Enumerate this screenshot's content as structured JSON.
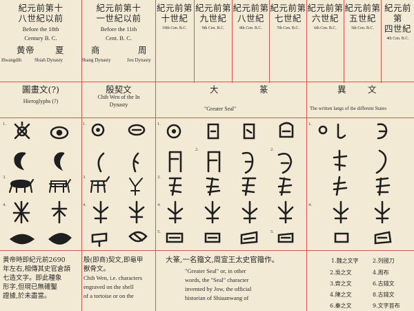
{
  "header": {
    "col1": {
      "cn_line1": "紀元前第十",
      "cn_line2": "八世紀以前",
      "en_line1": "Before the 18th",
      "en_line2": "Century B. C.",
      "cn_line3a": "黄帝",
      "cn_line3b": "夏",
      "en_line3a": "Hwangdih",
      "en_line3b": "Shiah Dynasty"
    },
    "col2": {
      "cn_line1": "紀元前第十",
      "cn_line2": "一世紀以前",
      "en_line1": "Before the 11th",
      "en_line2": "Cent. B. C.",
      "cn_line3a": "商",
      "cn_line3b": "周",
      "en_line3a": "Shang Dynasty",
      "en_line3b": "Jou Dynasty"
    },
    "cols": [
      {
        "cn_line1": "紀元前第",
        "cn_line2": "十世紀",
        "en": "10th Cen. B.C."
      },
      {
        "cn_line1": "紀元前第",
        "cn_line2": "九世紀",
        "en": "9th Cen. B.C."
      },
      {
        "cn_line1": "紀元前第",
        "cn_line2": "八世紀",
        "en": "8th Cen. B.C."
      },
      {
        "cn_line1": "紀元前第",
        "cn_line2": "七世紀",
        "en": "7th Cen. B.C."
      },
      {
        "cn_line1": "紀元前第",
        "cn_line2": "六世紀",
        "en": "6th Cen. B.C."
      },
      {
        "cn_line1": "紀元前第",
        "cn_line2": "五世紀",
        "en": "5th Cen. B.C."
      },
      {
        "cn_line1": "紀元前第",
        "cn_line2": "四世紀",
        "en": "4th Cen. B.C."
      }
    ]
  },
  "styles": {
    "s1_cn": "圖畫文(?)",
    "s1_en": "Hieroglyphs (?)",
    "s2_cn": "殷契文",
    "s2_en1": "Chih Wen of the In",
    "s2_en2": "Dynasty",
    "s3_cn_a": "大",
    "s3_cn_b": "篆",
    "s3_en": "\"Greater Seal\"",
    "s4_cn_a": "異",
    "s4_cn_b": "文",
    "s4_en": "The written langs of the different States"
  },
  "row_numbers": [
    "1.",
    "2.",
    "3.",
    "4.",
    "5."
  ],
  "descriptions": {
    "d1_cn_1": "黄帝時即紀元前2690",
    "d1_cn_2": "年左右,相傳其史官倉頡",
    "d1_cn_3": "七造文字。即此種象",
    "d1_cn_4": "形字,但現已無確鑿",
    "d1_cn_5": "證據,於未盡當。",
    "d2_cn_1": "殷(即商)契文,即龜甲",
    "d2_cn_2": "獸骨文。",
    "d2_en_1": "Chih Wen, i.e. characters",
    "d2_en_2": "engraved on the shell",
    "d2_en_3": "of a tortoise or on the",
    "d3_cn_1": "大篆,一名籀文,周宣王太史官籀作。",
    "d3_en_1": "\"Greater Seal\" or, in other",
    "d3_en_2": "words, the \"Seal\" character",
    "d3_en_2b": "invented by Jow, the official",
    "d3_en_3": "historian of Shiuanwang of"
  },
  "list": [
    {
      "n": "1.",
      "label": "魏之文字"
    },
    {
      "n": "2.",
      "label": "吳之文"
    },
    {
      "n": "3.",
      "label": "齊之文"
    },
    {
      "n": "4.",
      "label": "陳之文"
    },
    {
      "n": "5.",
      "label": "宋之文"
    },
    {
      "n": "6.",
      "label": "秦之文"
    },
    {
      "n": "2.",
      "label": "列國刀"
    },
    {
      "n": "4.",
      "label": "周布"
    },
    {
      "n": "6.",
      "label": "古錢文"
    },
    {
      "n": "8.",
      "label": "古錢文"
    },
    {
      "n": "9.",
      "label": "文字首布"
    }
  ],
  "colors": {
    "paper": "#f3ead5",
    "rule": "#d9534a",
    "ink": "#2a2a2a"
  }
}
